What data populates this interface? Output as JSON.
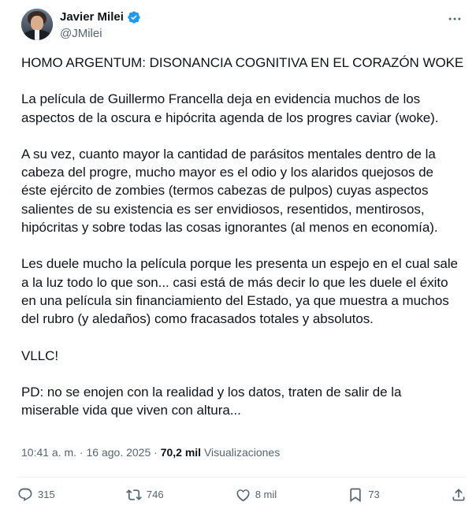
{
  "author": {
    "name": "Javier Milei",
    "handle": "@JMilei"
  },
  "tweet": {
    "paragraphs": [
      "HOMO ARGENTUM: DISONANCIA COGNITIVA EN EL CORAZÓN WOKE",
      "La película de Guillermo Francella deja en evidencia muchos de los\naspectos de la oscura e hipócrita agenda de los progres caviar (woke).",
      "A su vez, cuanto mayor la cantidad de parásitos mentales dentro de la\ncabeza del progre, mucho mayor es el odio y los alaridos quejosos de\néste ejército de zombies (termos cabezas de pulpos) cuyas aspectos\nsalientes de su existencia es ser envidiosos, resentidos, mentirosos,\nhipócritas y sobre todas las cosas ignorantes (al menos en economía).",
      "Les duele mucho la película porque les presenta un espejo en el cual sale\na la luz todo lo que son... casi está de más decir lo que les duele el éxito\nen una película sin financiamiento del Estado, ya que muestra a muchos\ndel rubro (y aledaños) como fracasados totales y absolutos.",
      "VLLC!",
      "PD: no se enojen con la realidad y los datos, traten de salir de la\nmiserable vida que viven con altura..."
    ]
  },
  "meta": {
    "time": "10:41 a. m.",
    "separator": " · ",
    "date": "16 ago. 2025",
    "views_count": "70,2 mil",
    "views_label": " Visualizaciones"
  },
  "actions": {
    "replies": "315",
    "reposts": "746",
    "likes": "8 mil",
    "bookmarks": "73"
  },
  "colors": {
    "text": "#0f1419",
    "secondary": "#536471",
    "verified": "#1d9bf0"
  },
  "icons": [
    "verified-badge-icon",
    "more-icon",
    "reply-icon",
    "repost-icon",
    "like-icon",
    "bookmark-icon",
    "share-icon"
  ]
}
